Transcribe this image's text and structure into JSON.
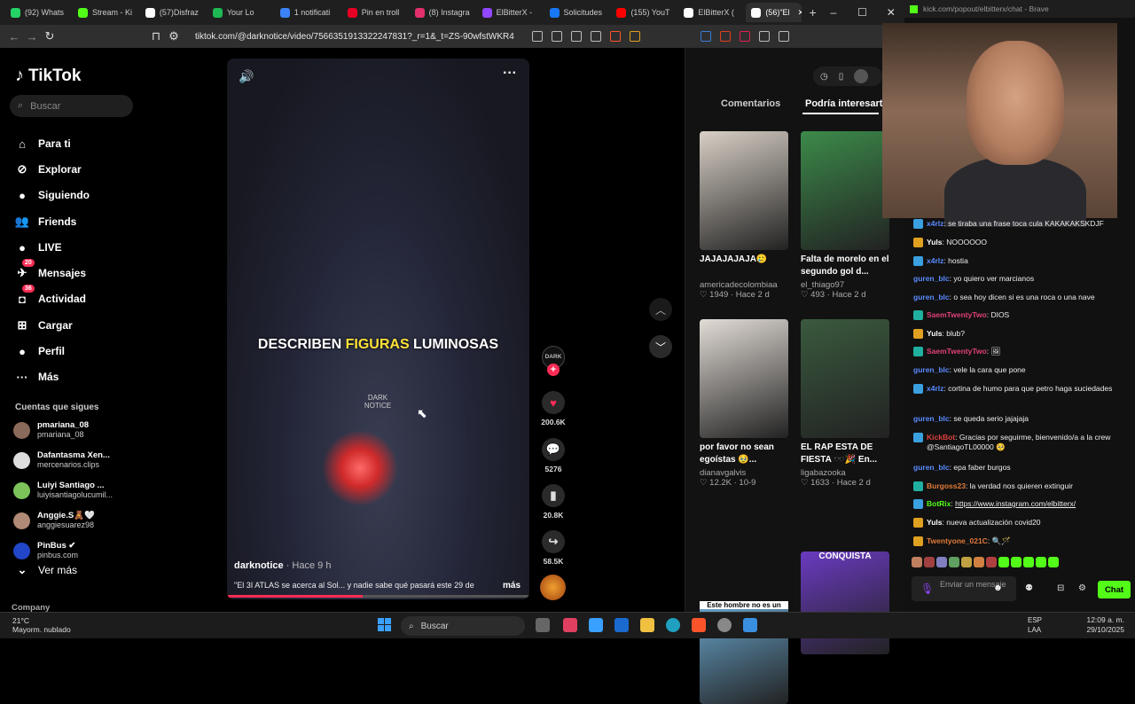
{
  "browser": {
    "tabs": [
      {
        "label": "(92) Whats",
        "color": "#25d366"
      },
      {
        "label": "Stream - Ki",
        "color": "#53fc18"
      },
      {
        "label": "(57)Disfraz",
        "color": "#ffffff"
      },
      {
        "label": "Your Lo",
        "color": "#1db954"
      },
      {
        "label": "1 notificati",
        "color": "#3b82f6"
      },
      {
        "label": "Pin en troll",
        "color": "#e60023"
      },
      {
        "label": "(8) Instagra",
        "color": "#e1306c"
      },
      {
        "label": "ElBitterX -",
        "color": "#9146ff"
      },
      {
        "label": "Solicitudes",
        "color": "#1877f2"
      },
      {
        "label": "(155) YouT",
        "color": "#ff0000"
      },
      {
        "label": "ElBitterX (",
        "color": "#ffffff"
      },
      {
        "label": "(56)\"El",
        "color": "#ffffff"
      }
    ],
    "url": "tiktok.com/@darknotice/video/7566351913322247831?_r=1&_t=ZS-90wfstWKR4Z"
  },
  "tiktok": {
    "logo": "TikTok",
    "search_placeholder": "Buscar",
    "nav": [
      {
        "label": "Para ti",
        "icon": "home-icon",
        "glyph": "⌂"
      },
      {
        "label": "Explorar",
        "icon": "compass-icon",
        "glyph": "⊘"
      },
      {
        "label": "Siguiendo",
        "icon": "following-icon",
        "glyph": "●"
      },
      {
        "label": "Friends",
        "icon": "friends-icon",
        "glyph": "👥"
      },
      {
        "label": "LIVE",
        "icon": "live-icon",
        "glyph": "●"
      },
      {
        "label": "Mensajes",
        "icon": "messages-icon",
        "glyph": "✈",
        "badge": "20"
      },
      {
        "label": "Actividad",
        "icon": "activity-icon",
        "glyph": "◘",
        "badge": "36"
      },
      {
        "label": "Cargar",
        "icon": "upload-icon",
        "glyph": "⊞"
      },
      {
        "label": "Perfil",
        "icon": "profile-icon",
        "glyph": "●"
      },
      {
        "label": "Más",
        "icon": "more-icon",
        "glyph": "···"
      }
    ],
    "following_title": "Cuentas que sigues",
    "following": [
      {
        "name": "pmariana_08",
        "handle": "pmariana_08",
        "color": "#8a6a5a"
      },
      {
        "name": "Dafantasma Xen...",
        "handle": "mercenarios.clips",
        "color": "#dddddd"
      },
      {
        "name": "Luiyi Santiago ...",
        "handle": "luiyisantiagolucumil...",
        "color": "#7cc45a"
      },
      {
        "name": "Anggie.S🧸🤍",
        "handle": "anggiesuarez98",
        "color": "#b08a76"
      },
      {
        "name": "PinBus ✔",
        "handle": "pinbus.com",
        "color": "#2246c9"
      }
    ],
    "see_more": "Ver más",
    "company": "Company",
    "video": {
      "caption_before": "DESCRIBEN ",
      "caption_highlight": "FIGURAS",
      "caption_after": " LUMINOSAS",
      "watermark": "DARK NOTICE",
      "author": "darknotice",
      "time": " · Hace 9 h",
      "description": "\"El 3I ATLAS se acerca al Sol... y nadie sabe qué pasará este 29 de",
      "more": "más",
      "progress": 0.45
    },
    "actions": {
      "avatar_label": "DARK",
      "likes": "200.6K",
      "comments": "5276",
      "saves": "20.8K",
      "shares": "58.5K"
    },
    "right_tabs": [
      "Comentarios",
      "Podría interesarte"
    ],
    "cards": [
      {
        "title": "JAJAJAJAJA🥲",
        "author": "americadecolombiaa",
        "stats": "♡ 1949 · Hace 2 d",
        "color": "#d8d0c6"
      },
      {
        "title": "Falta de morelo en el segundo gol d...",
        "author": "el_thiago97",
        "stats": "♡ 493 · Hace 2 d",
        "color": "#3c8a4a"
      },
      {
        "title": "por favor no sean egoístas 🥹...",
        "author": "dianavgalvis",
        "stats": "♡ 12.2K · 10-9",
        "color": "#e2dcd6"
      },
      {
        "title": "EL RAP ESTA DE FIESTA 🕶️🎉 En...",
        "author": "ligabazooka",
        "stats": "♡ 1633 · Hace 2 d",
        "color": "#3a5a3e"
      },
      {
        "title": "Este hombre no es un",
        "author": "",
        "stats": "",
        "color": "#6aa8d0"
      },
      {
        "title": "CONQUISTA",
        "author": "",
        "stats": "",
        "color": "#6a3ac0"
      }
    ]
  },
  "kick": {
    "url": "kick.com/popout/elbitterx/chat - Brave",
    "messages": [
      {
        "nick": "x4rlz",
        "color": "#5a8bff",
        "badge": "#3aa0e0",
        "text": "se tiraba una frase toca cula KAKAKAKSKDJF"
      },
      {
        "nick": "Yuls",
        "color": "#ffffff",
        "badge": "#e0a020",
        "text": "NOOOOOO"
      },
      {
        "nick": "x4rlz",
        "color": "#5a8bff",
        "badge": "#3aa0e0",
        "text": "hostia"
      },
      {
        "nick": "guren_blc",
        "color": "#5a8bff",
        "badge": "",
        "text": "yo quiero ver marcianos"
      },
      {
        "nick": "guren_blc",
        "color": "#5a8bff",
        "badge": "",
        "text": "o sea hoy dicen si es una roca o una nave"
      },
      {
        "nick": "SaemTwentyTwo",
        "color": "#e0407a",
        "badge": "#20b0a0",
        "text": "DIOS"
      },
      {
        "nick": "Yuls",
        "color": "#ffffff",
        "badge": "#e0a020",
        "text": "blub?"
      },
      {
        "nick": "SaemTwentyTwo",
        "color": "#e0407a",
        "badge": "#20b0a0",
        "text": "🖼"
      },
      {
        "nick": "guren_blc",
        "color": "#5a8bff",
        "badge": "",
        "text": "vele la cara que pone"
      },
      {
        "nick": "x4rlz",
        "color": "#5a8bff",
        "badge": "#3aa0e0",
        "text": "cortina de humo para que petro haga suciedades"
      },
      {
        "nick": "guren_blc",
        "color": "#5a8bff",
        "badge": "",
        "text": "se queda serio jajajaja"
      },
      {
        "nick": "KickBot",
        "color": "#e04040",
        "badge": "#3aa0e0",
        "text": "Gracias por seguirme, bienvenido/a a la crew @SantiagoTL00000 🥺"
      },
      {
        "nick": "guren_blc",
        "color": "#5a8bff",
        "badge": "",
        "text": "epa faber burgos"
      },
      {
        "nick": "Burgoss23",
        "color": "#e07a3a",
        "badge": "#20b0a0",
        "text": "la verdad nos quieren extinguir"
      },
      {
        "nick": "BotRix",
        "color": "#53fc18",
        "badge": "#3aa0e0",
        "text": "https://www.instagram.com/elbitterx/"
      },
      {
        "nick": "Yuls",
        "color": "#ffffff",
        "badge": "#e0a020",
        "text": "nueva actualización covid20"
      },
      {
        "nick": "Twentyone_021C",
        "color": "#e07a3a",
        "badge": "#e0a020",
        "text": "🔍🪄"
      }
    ],
    "input_placeholder": "Enviar un mensaje",
    "chat_button": "Chat"
  },
  "taskbar": {
    "temp": "21°C",
    "weather": "Mayorm. nublado",
    "search": "Buscar",
    "lang1": "ESP",
    "lang2": "LAA",
    "time": "12:09 a. m.",
    "date": "29/10/2025"
  }
}
